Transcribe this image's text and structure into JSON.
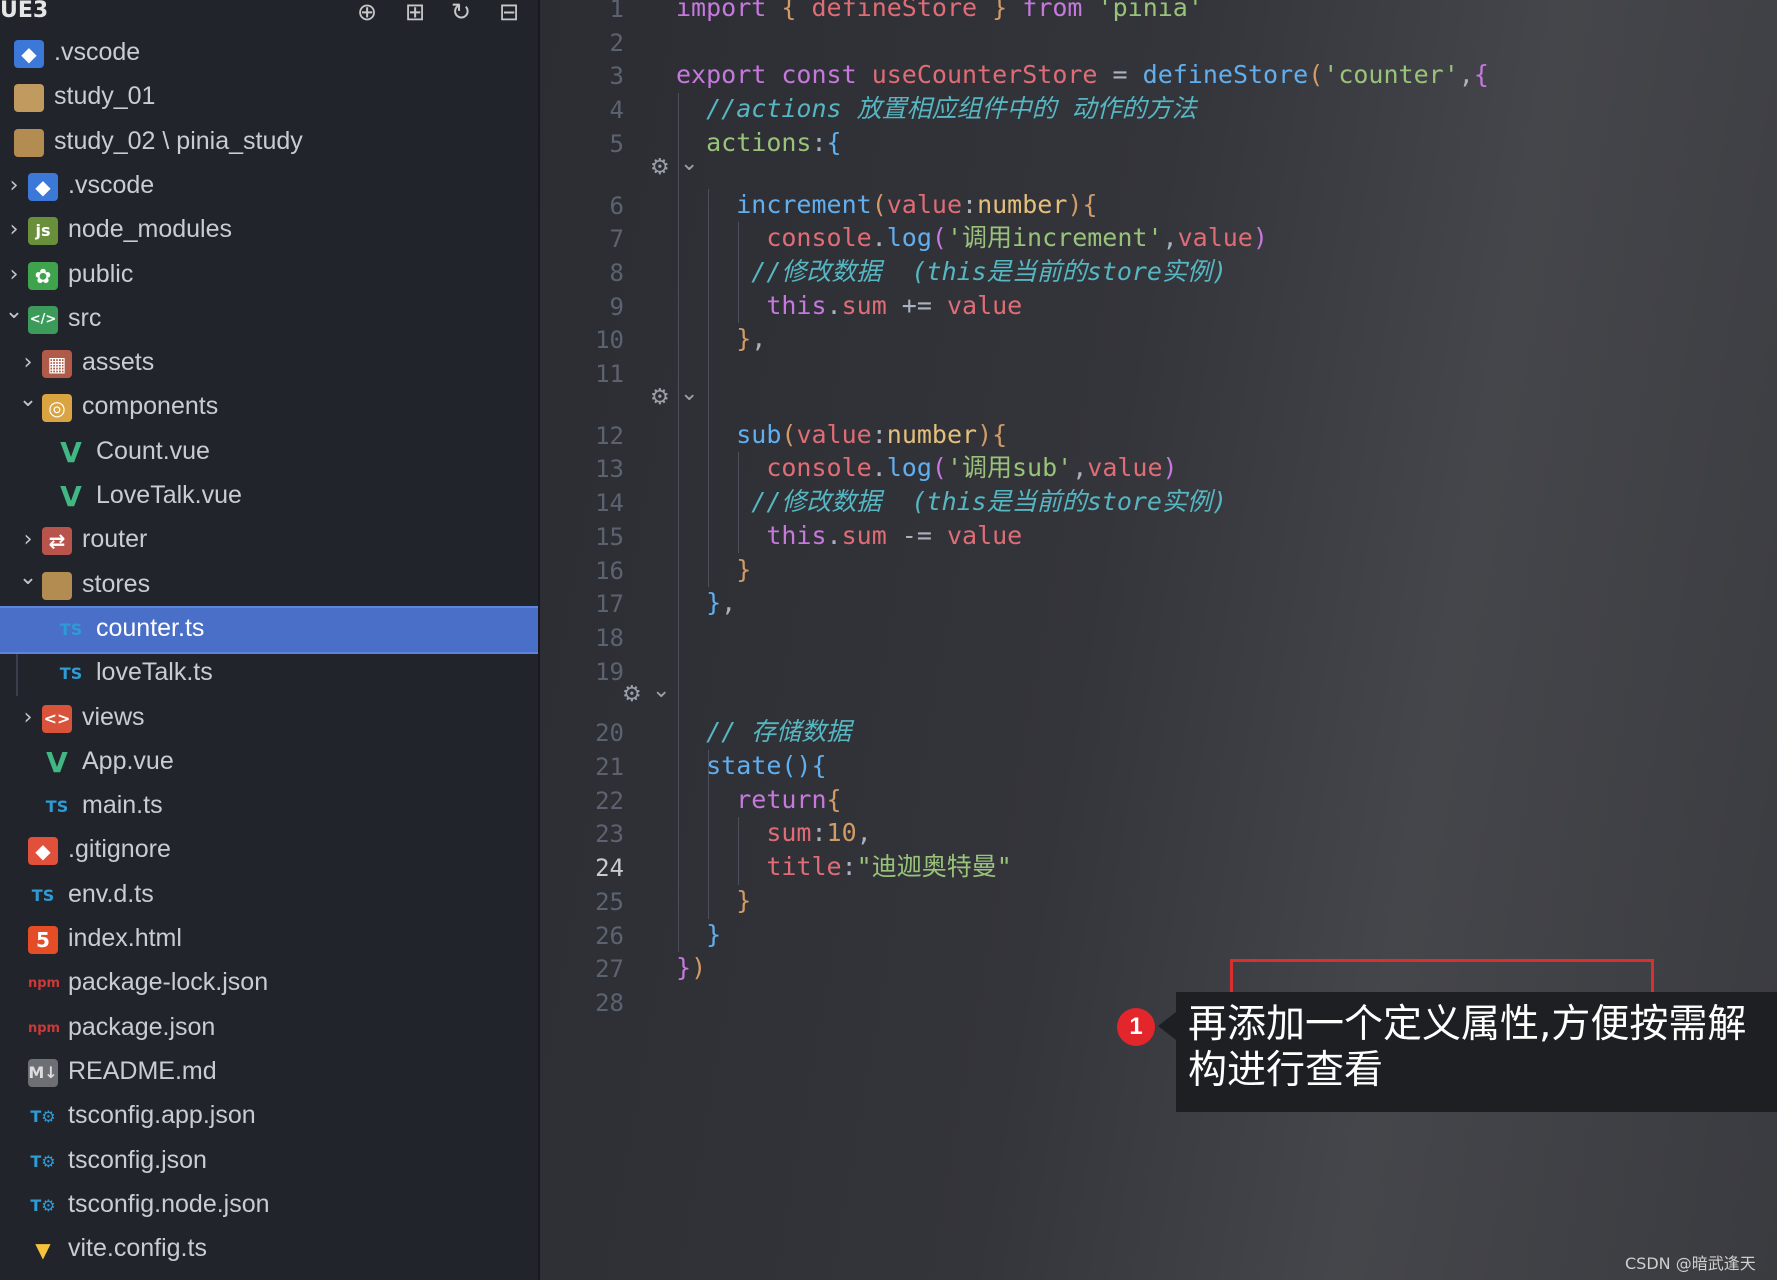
{
  "sidebar": {
    "title": "UE3",
    "actions": [
      {
        "name": "new-file-icon",
        "glyph": "⊕"
      },
      {
        "name": "new-folder-icon",
        "glyph": "⊞"
      },
      {
        "name": "refresh-icon",
        "glyph": "↻"
      },
      {
        "name": "collapse-all-icon",
        "glyph": "⊟"
      }
    ],
    "tree": [
      {
        "label": ".vscode",
        "icon": "vscode-folder-icon",
        "depth": 0,
        "chevron": ""
      },
      {
        "label": "study_01",
        "icon": "folder-icon",
        "depth": 0,
        "chevron": ""
      },
      {
        "label": "study_02 \\ pinia_study",
        "icon": "folder-open-icon",
        "depth": 0,
        "chevron": ""
      },
      {
        "label": ".vscode",
        "icon": "vscode-folder-icon",
        "depth": 1,
        "chevron": "›"
      },
      {
        "label": "node_modules",
        "icon": "node-modules-folder-icon",
        "depth": 1,
        "chevron": "›"
      },
      {
        "label": "public",
        "icon": "public-folder-icon",
        "depth": 1,
        "chevron": "›"
      },
      {
        "label": "src",
        "icon": "src-folder-icon",
        "depth": 1,
        "chevron": "⌄"
      },
      {
        "label": "assets",
        "icon": "assets-folder-icon",
        "depth": 2,
        "chevron": "›"
      },
      {
        "label": "components",
        "icon": "components-folder-icon",
        "depth": 2,
        "chevron": "⌄"
      },
      {
        "label": "Count.vue",
        "icon": "vue-file-icon",
        "depth": 3,
        "chevron": ""
      },
      {
        "label": "LoveTalk.vue",
        "icon": "vue-file-icon",
        "depth": 3,
        "chevron": ""
      },
      {
        "label": "router",
        "icon": "router-folder-icon",
        "depth": 2,
        "chevron": "›"
      },
      {
        "label": "stores",
        "icon": "folder-open-icon",
        "depth": 2,
        "chevron": "⌄"
      },
      {
        "label": "counter.ts",
        "icon": "ts-file-icon",
        "depth": 3,
        "chevron": "",
        "selected": true
      },
      {
        "label": "loveTalk.ts",
        "icon": "ts-file-icon",
        "depth": 3,
        "chevron": ""
      },
      {
        "label": "views",
        "icon": "views-folder-icon",
        "depth": 2,
        "chevron": "›"
      },
      {
        "label": "App.vue",
        "icon": "vue-file-icon",
        "depth": 2,
        "chevron": ""
      },
      {
        "label": "main.ts",
        "icon": "ts-file-icon",
        "depth": 2,
        "chevron": ""
      },
      {
        "label": ".gitignore",
        "icon": "git-icon",
        "depth": 1,
        "chevron": ""
      },
      {
        "label": "env.d.ts",
        "icon": "ts-file-icon",
        "depth": 1,
        "chevron": ""
      },
      {
        "label": "index.html",
        "icon": "html-file-icon",
        "depth": 1,
        "chevron": ""
      },
      {
        "label": "package-lock.json",
        "icon": "npm-icon",
        "depth": 1,
        "chevron": ""
      },
      {
        "label": "package.json",
        "icon": "npm-icon",
        "depth": 1,
        "chevron": ""
      },
      {
        "label": "README.md",
        "icon": "markdown-icon",
        "depth": 1,
        "chevron": ""
      },
      {
        "label": "tsconfig.app.json",
        "icon": "tsconfig-icon",
        "depth": 1,
        "chevron": ""
      },
      {
        "label": "tsconfig.json",
        "icon": "tsconfig-icon",
        "depth": 1,
        "chevron": ""
      },
      {
        "label": "tsconfig.node.json",
        "icon": "tsconfig-icon",
        "depth": 1,
        "chevron": ""
      },
      {
        "label": "vite.config.ts",
        "icon": "vite-icon",
        "depth": 1,
        "chevron": ""
      }
    ]
  },
  "editor": {
    "current_line": 24,
    "lines": [
      {
        "n": "1",
        "tokens": [
          [
            "kw",
            "import"
          ],
          [
            "pl",
            " "
          ],
          [
            "br1",
            "{"
          ],
          [
            "pl",
            " "
          ],
          [
            "prop",
            "defineStore"
          ],
          [
            "pl",
            " "
          ],
          [
            "br1",
            "}"
          ],
          [
            "pl",
            " "
          ],
          [
            "kw",
            "from"
          ],
          [
            "pl",
            " "
          ],
          [
            "str",
            "'pinia'"
          ]
        ]
      },
      {
        "n": "2",
        "tokens": []
      },
      {
        "n": "3",
        "tokens": [
          [
            "kw",
            "export"
          ],
          [
            "pl",
            " "
          ],
          [
            "kw",
            "const"
          ],
          [
            "pl",
            " "
          ],
          [
            "prop",
            "useCounterStore"
          ],
          [
            "pl",
            " = "
          ],
          [
            "fn",
            "defineStore"
          ],
          [
            "br1",
            "("
          ],
          [
            "str",
            "'counter'"
          ],
          [
            "pl",
            ","
          ],
          [
            "br2",
            "{"
          ]
        ]
      },
      {
        "n": "4",
        "tokens": [
          [
            "pl",
            "  "
          ],
          [
            "cm",
            "//actions 放置相应组件中的 动作的方法"
          ]
        ]
      },
      {
        "n": "5",
        "tokens": [
          [
            "pl",
            "  "
          ],
          [
            "str",
            "actions"
          ],
          [
            "pl",
            ":"
          ],
          [
            "br3",
            "{"
          ]
        ]
      },
      {
        "n": "6",
        "tokens": [
          [
            "pl",
            "    "
          ],
          [
            "fn",
            "increment"
          ],
          [
            "br1",
            "("
          ],
          [
            "prop",
            "value"
          ],
          [
            "pl",
            ":"
          ],
          [
            "ty",
            "number"
          ],
          [
            "br1",
            ")"
          ],
          [
            "br1",
            "{"
          ]
        ]
      },
      {
        "n": "7",
        "tokens": [
          [
            "pl",
            "      "
          ],
          [
            "prop",
            "console"
          ],
          [
            "pl",
            "."
          ],
          [
            "fn",
            "log"
          ],
          [
            "br2",
            "("
          ],
          [
            "str",
            "'调用increment'"
          ],
          [
            "pl",
            ","
          ],
          [
            "prop",
            "value"
          ],
          [
            "br2",
            ")"
          ]
        ]
      },
      {
        "n": "8",
        "tokens": [
          [
            "pl",
            "     "
          ],
          [
            "cm",
            "//修改数据  (this是当前的store实例)"
          ]
        ]
      },
      {
        "n": "9",
        "tokens": [
          [
            "pl",
            "      "
          ],
          [
            "kw",
            "this"
          ],
          [
            "pl",
            "."
          ],
          [
            "prop",
            "sum"
          ],
          [
            "pl",
            " += "
          ],
          [
            "prop",
            "value"
          ]
        ]
      },
      {
        "n": "10",
        "tokens": [
          [
            "pl",
            "    "
          ],
          [
            "br1",
            "}"
          ],
          [
            "pl",
            ","
          ]
        ]
      },
      {
        "n": "11",
        "tokens": []
      },
      {
        "n": "12",
        "tokens": [
          [
            "pl",
            "    "
          ],
          [
            "fn",
            "sub"
          ],
          [
            "br1",
            "("
          ],
          [
            "prop",
            "value"
          ],
          [
            "pl",
            ":"
          ],
          [
            "ty",
            "number"
          ],
          [
            "br1",
            ")"
          ],
          [
            "br1",
            "{"
          ]
        ]
      },
      {
        "n": "13",
        "tokens": [
          [
            "pl",
            "      "
          ],
          [
            "prop",
            "console"
          ],
          [
            "pl",
            "."
          ],
          [
            "fn",
            "log"
          ],
          [
            "br2",
            "("
          ],
          [
            "str",
            "'调用sub'"
          ],
          [
            "pl",
            ","
          ],
          [
            "prop",
            "value"
          ],
          [
            "br2",
            ")"
          ]
        ]
      },
      {
        "n": "14",
        "tokens": [
          [
            "pl",
            "     "
          ],
          [
            "cm",
            "//修改数据  (this是当前的store实例)"
          ]
        ]
      },
      {
        "n": "15",
        "tokens": [
          [
            "pl",
            "      "
          ],
          [
            "kw",
            "this"
          ],
          [
            "pl",
            "."
          ],
          [
            "prop",
            "sum"
          ],
          [
            "pl",
            " -= "
          ],
          [
            "prop",
            "value"
          ]
        ]
      },
      {
        "n": "16",
        "tokens": [
          [
            "pl",
            "    "
          ],
          [
            "br1",
            "}"
          ]
        ]
      },
      {
        "n": "17",
        "tokens": [
          [
            "pl",
            "  "
          ],
          [
            "br3",
            "}"
          ],
          [
            "pl",
            ","
          ]
        ]
      },
      {
        "n": "18",
        "tokens": []
      },
      {
        "n": "19",
        "tokens": []
      },
      {
        "n": "20",
        "tokens": [
          [
            "pl",
            "  "
          ],
          [
            "cm",
            "// 存储数据"
          ]
        ]
      },
      {
        "n": "21",
        "tokens": [
          [
            "pl",
            "  "
          ],
          [
            "fn",
            "state"
          ],
          [
            "br3",
            "()"
          ],
          [
            "br3",
            "{"
          ]
        ]
      },
      {
        "n": "22",
        "tokens": [
          [
            "pl",
            "    "
          ],
          [
            "kw",
            "return"
          ],
          [
            "br1",
            "{"
          ]
        ]
      },
      {
        "n": "23",
        "tokens": [
          [
            "pl",
            "      "
          ],
          [
            "prop",
            "sum"
          ],
          [
            "pl",
            ":"
          ],
          [
            "num",
            "10"
          ],
          [
            "pl",
            ","
          ]
        ]
      },
      {
        "n": "24",
        "tokens": [
          [
            "pl",
            "      "
          ],
          [
            "prop",
            "title"
          ],
          [
            "pl",
            ":"
          ],
          [
            "str",
            "\"迪迦奥特曼\""
          ]
        ]
      },
      {
        "n": "25",
        "tokens": [
          [
            "pl",
            "    "
          ],
          [
            "br1",
            "}"
          ]
        ]
      },
      {
        "n": "26",
        "tokens": [
          [
            "pl",
            "  "
          ],
          [
            "br3",
            "}"
          ]
        ]
      },
      {
        "n": "27",
        "tokens": [
          [
            "br2",
            "}"
          ],
          [
            "br1",
            ")"
          ]
        ]
      },
      {
        "n": "28",
        "tokens": []
      }
    ],
    "codelens_icon": "copilot-icon",
    "codelens_chevron": "⌄"
  },
  "annotation": {
    "number": "1",
    "text": "再添加一个定义属性,方便按需解构进行查看"
  },
  "watermark": "CSDN @暗武逢天",
  "colors": {
    "sidebar_bg": "#21252b",
    "selection": "#4a6fc8",
    "highlight_box": "#d8302f",
    "callout_bg": "#1e1f22",
    "badge": "#e2262c"
  }
}
